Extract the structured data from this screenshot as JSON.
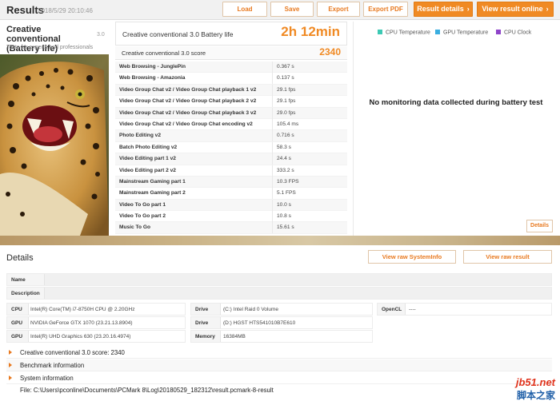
{
  "header": {
    "title": "Results",
    "date": "2018/5/29 20:10:46",
    "buttons": {
      "load": "Load",
      "save": "Save",
      "export": "Export",
      "export_pdf": "Export PDF",
      "result_details": "Result details",
      "view_online": "View result online"
    }
  },
  "benchmark": {
    "title": "Creative conventional (Battery life)",
    "version": "3.0",
    "description": "Tests for experts and professionals"
  },
  "score": {
    "label": "Creative conventional 3.0 Battery life",
    "value": "2h 12min",
    "score_label": "Creative conventional 3.0 score",
    "score_value": "2340"
  },
  "results": [
    {
      "name": "Web Browsing - JunglePin",
      "value": "0.367 s"
    },
    {
      "name": "Web Browsing - Amazonia",
      "value": "0.137 s"
    },
    {
      "name": "Video Group Chat v2 / Video Group Chat playback 1 v2",
      "value": "29.1 fps"
    },
    {
      "name": "Video Group Chat v2 / Video Group Chat playback 2 v2",
      "value": "29.1 fps"
    },
    {
      "name": "Video Group Chat v2 / Video Group Chat playback 3 v2",
      "value": "29.0 fps"
    },
    {
      "name": "Video Group Chat v2 / Video Group Chat encoding v2",
      "value": "105.4 ms"
    },
    {
      "name": "Photo Editing v2",
      "value": "0.716 s"
    },
    {
      "name": "Batch Photo Editing v2",
      "value": "58.3 s"
    },
    {
      "name": "Video Editing part 1 v2",
      "value": "24.4 s"
    },
    {
      "name": "Video Editing part 2 v2",
      "value": "333.2 s"
    },
    {
      "name": "Mainstream Gaming part 1",
      "value": "10.3 FPS"
    },
    {
      "name": "Mainstream Gaming part 2",
      "value": "5.1 FPS"
    },
    {
      "name": "Video To Go part 1",
      "value": "10.0 s"
    },
    {
      "name": "Video To Go part 2",
      "value": "10.8 s"
    },
    {
      "name": "Music To Go",
      "value": "15.61 s"
    }
  ],
  "monitoring": {
    "legend": [
      {
        "label": "CPU Temperature",
        "color": "#3cc9b4"
      },
      {
        "label": "GPU Temperature",
        "color": "#3aaee0"
      },
      {
        "label": "CPU Clock",
        "color": "#8e44c9"
      }
    ],
    "no_data": "No monitoring data collected during battery test",
    "details_button": "Details"
  },
  "details": {
    "title": "Details",
    "view_systeminfo": "View raw SystemInfo",
    "view_result": "View raw result",
    "name_label": "Name",
    "description_label": "Description",
    "hardware": {
      "cpu_label": "CPU",
      "cpu_value": "Intel(R) Core(TM) i7-8750H CPU @ 2.20GHz",
      "gpu1_label": "GPU",
      "gpu1_value": "NVIDIA GeForce GTX 1070 (23.21.13.8904)",
      "gpu2_label": "GPU",
      "gpu2_value": "Intel(R) UHD Graphics 630 (23.20.16.4974)",
      "drive1_label": "Drive",
      "drive1_value": "(C:) Intel Raid 0 Volume",
      "drive2_label": "Drive",
      "drive2_value": "(D:) HGST HTS541010B7E610",
      "memory_label": "Memory",
      "memory_value": "16384MB",
      "opencl_label": "OpenCL",
      "opencl_value": "----"
    },
    "accordion": [
      "Creative conventional 3.0 score: 2340",
      "Benchmark information",
      "System information"
    ],
    "file": "File: C:\\Users\\pconline\\Documents\\PCMark 8\\Log\\20180529_182312\\result.pcmark-8-result"
  },
  "watermark": {
    "line1": "jb51.net",
    "line2": "脚本之家"
  }
}
